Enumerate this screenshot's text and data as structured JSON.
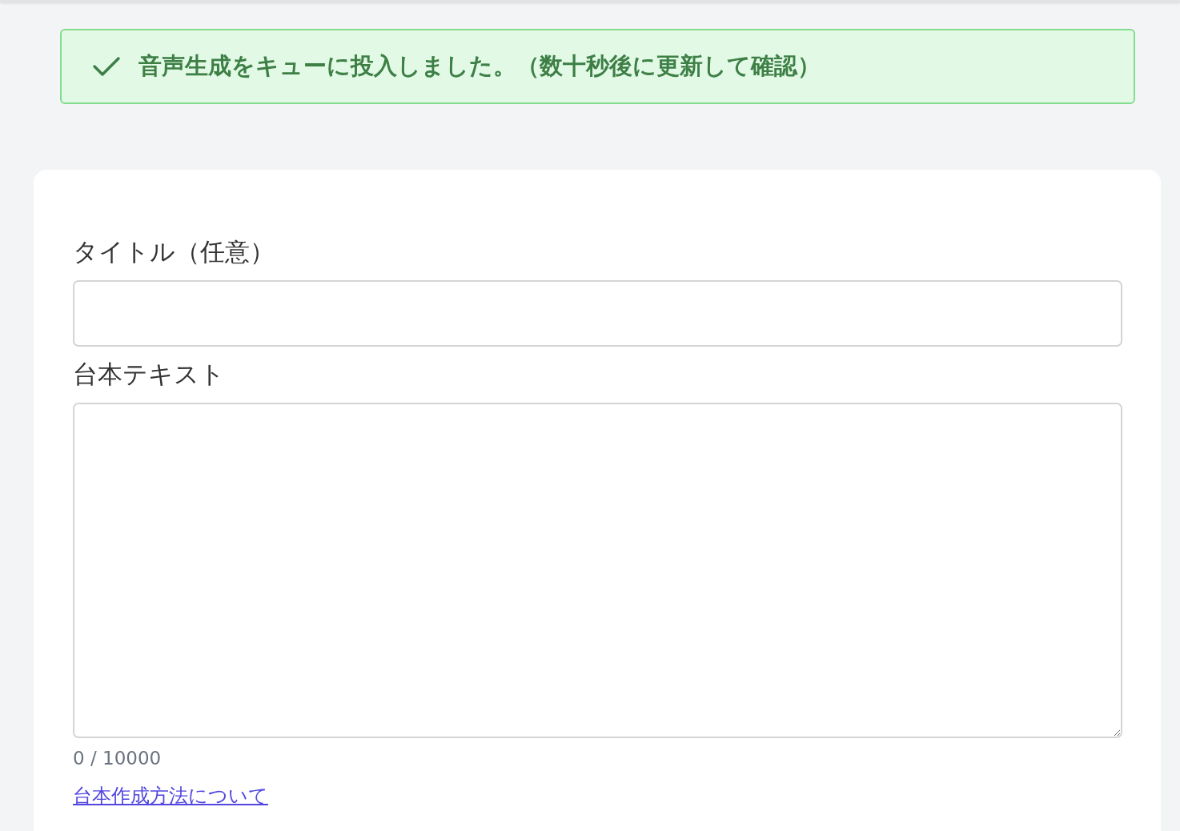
{
  "alert": {
    "kind": "success",
    "message": "音声生成をキューに投入しました。（数十秒後に更新して確認）"
  },
  "form": {
    "title_field": {
      "label": "タイトル（任意）"
    },
    "script_field": {
      "label": "台本テキスト",
      "counter": "0 / 10000"
    },
    "help_link": "台本作成方法について"
  }
}
